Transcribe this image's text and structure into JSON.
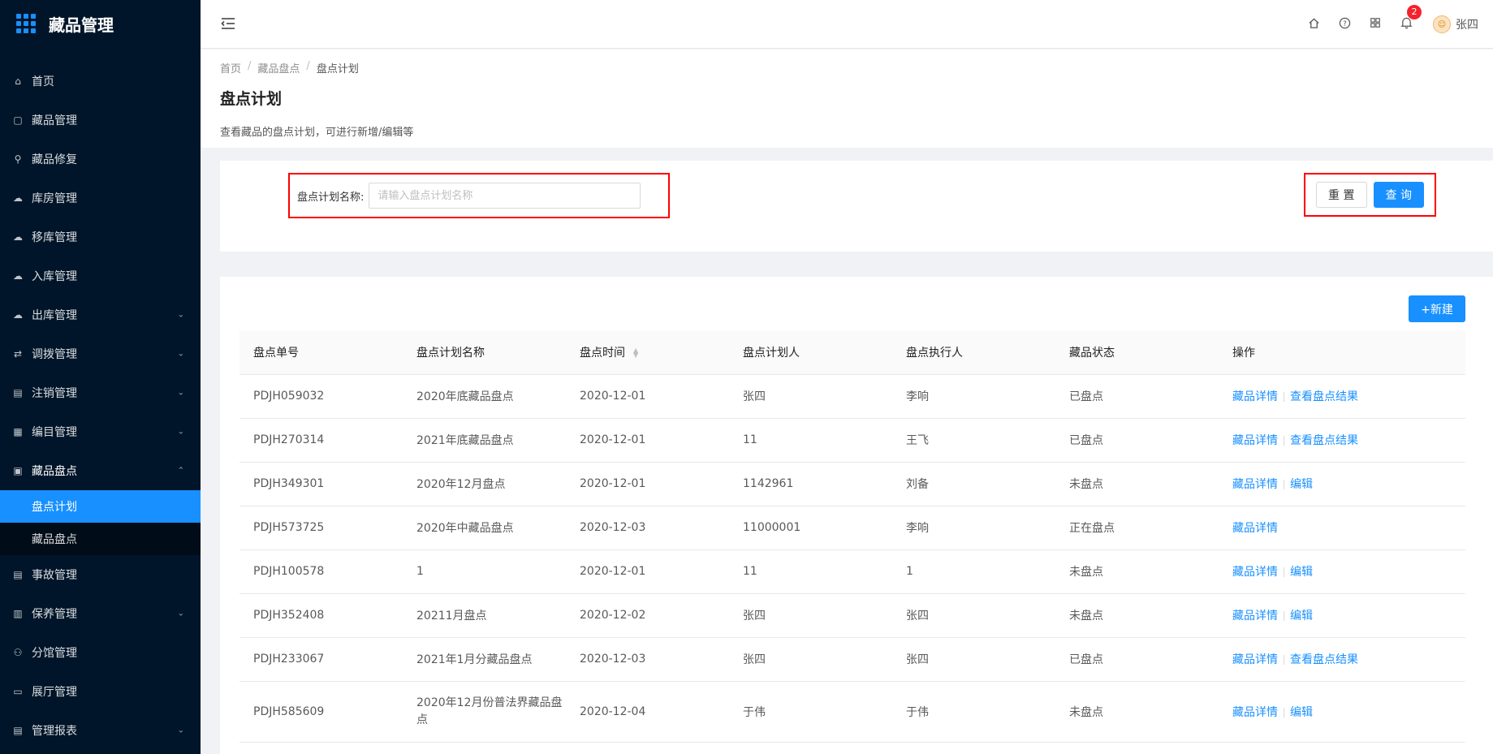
{
  "app": {
    "title": "藏品管理",
    "logo_icon": "grid-icon"
  },
  "sidebar": {
    "items": [
      {
        "label": "首页",
        "icon": "home-icon"
      },
      {
        "label": "藏品管理",
        "icon": "calendar-icon"
      },
      {
        "label": "藏品修复",
        "icon": "wrench-icon"
      },
      {
        "label": "库房管理",
        "icon": "warehouse-icon"
      },
      {
        "label": "移库管理",
        "icon": "cloud-icon"
      },
      {
        "label": "入库管理",
        "icon": "upload-cloud-icon"
      },
      {
        "label": "出库管理",
        "icon": "download-cloud-icon",
        "has_children": true
      },
      {
        "label": "调拨管理",
        "icon": "transfer-icon",
        "has_children": true
      },
      {
        "label": "注销管理",
        "icon": "document-icon",
        "has_children": true
      },
      {
        "label": "编目管理",
        "icon": "catalog-icon",
        "has_children": true
      },
      {
        "label": "藏品盘点",
        "icon": "inventory-icon",
        "has_children": true,
        "open": true
      },
      {
        "label": "事故管理",
        "icon": "incident-icon"
      },
      {
        "label": "保养管理",
        "icon": "maintenance-icon",
        "has_children": true
      },
      {
        "label": "分馆管理",
        "icon": "branch-icon"
      },
      {
        "label": "展厅管理",
        "icon": "monitor-icon"
      },
      {
        "label": "管理报表",
        "icon": "report-icon",
        "has_children": true
      }
    ],
    "submenu": [
      {
        "label": "盘点计划",
        "active": true
      },
      {
        "label": "藏品盘点",
        "active": false
      }
    ]
  },
  "header": {
    "notification_count": "2",
    "user_name": "张四"
  },
  "breadcrumb": [
    "首页",
    "藏品盘点",
    "盘点计划"
  ],
  "page": {
    "title": "盘点计划",
    "description": "查看藏品的盘点计划，可进行新增/编辑等"
  },
  "search": {
    "label": "盘点计划名称:",
    "placeholder": "请输入盘点计划名称",
    "value": "",
    "reset_label": "重 置",
    "query_label": "查 询"
  },
  "table": {
    "new_label": "+新建",
    "columns": [
      "盘点单号",
      "盘点计划名称",
      "盘点时间",
      "盘点计划人",
      "盘点执行人",
      "藏品状态",
      "操作"
    ],
    "rows": [
      {
        "id": "PDJH059032",
        "name": "2020年底藏品盘点",
        "date": "2020-12-01",
        "planner": "张四",
        "executor": "李响",
        "status": "已盘点",
        "actions": [
          "藏品详情",
          "查看盘点结果"
        ]
      },
      {
        "id": "PDJH270314",
        "name": "2021年底藏品盘点",
        "date": "2020-12-01",
        "planner": "11",
        "executor": "王飞",
        "status": "已盘点",
        "actions": [
          "藏品详情",
          "查看盘点结果"
        ]
      },
      {
        "id": "PDJH349301",
        "name": "2020年12月盘点",
        "date": "2020-12-01",
        "planner": "1142961",
        "executor": "刘备",
        "status": "未盘点",
        "actions": [
          "藏品详情",
          "编辑"
        ]
      },
      {
        "id": "PDJH573725",
        "name": "2020年中藏品盘点",
        "date": "2020-12-03",
        "planner": "11000001",
        "executor": "李响",
        "status": "正在盘点",
        "actions": [
          "藏品详情"
        ]
      },
      {
        "id": "PDJH100578",
        "name": "1",
        "date": "2020-12-01",
        "planner": "11",
        "executor": "1",
        "status": "未盘点",
        "actions": [
          "藏品详情",
          "编辑"
        ]
      },
      {
        "id": "PDJH352408",
        "name": "20211月盘点",
        "date": "2020-12-02",
        "planner": "张四",
        "executor": "张四",
        "status": "未盘点",
        "actions": [
          "藏品详情",
          "编辑"
        ]
      },
      {
        "id": "PDJH233067",
        "name": "2021年1月分藏品盘点",
        "date": "2020-12-03",
        "planner": "张四",
        "executor": "张四",
        "status": "已盘点",
        "actions": [
          "藏品详情",
          "查看盘点结果"
        ]
      },
      {
        "id": "PDJH585609",
        "name": "2020年12月份普法界藏品盘点",
        "date": "2020-12-04",
        "planner": "于伟",
        "executor": "于伟",
        "status": "未盘点",
        "actions": [
          "藏品详情",
          "编辑"
        ]
      }
    ]
  },
  "colors": {
    "sidebar_bg": "#001529",
    "accent": "#1890ff",
    "highlight_border": "#ff0000"
  }
}
